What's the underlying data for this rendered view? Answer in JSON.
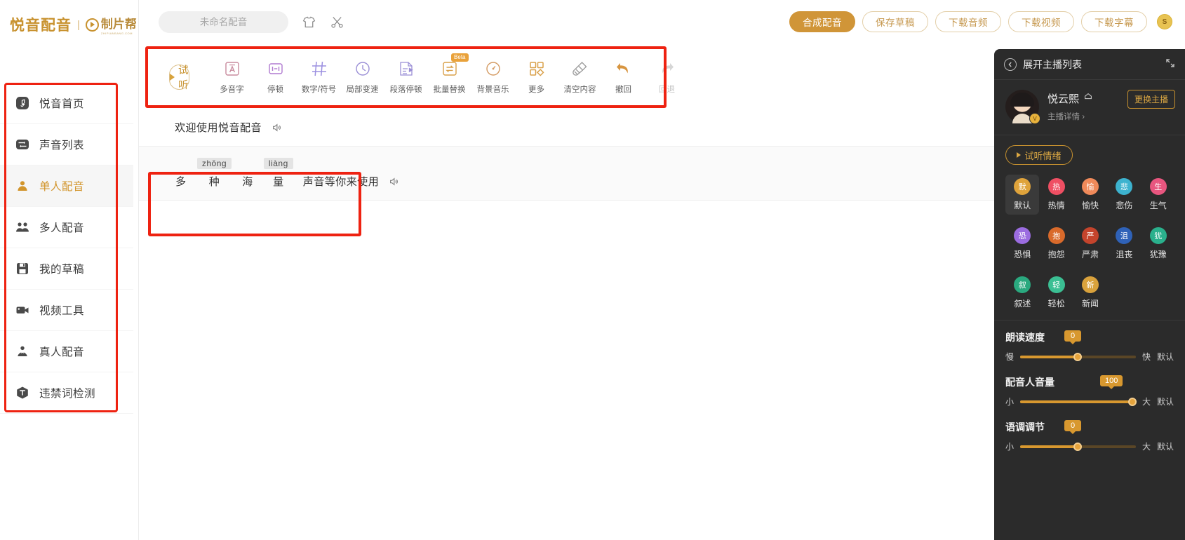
{
  "brand": {
    "name": "悦音配音",
    "divider": "|",
    "partner": "制片帮",
    "partner_sub": "ZHIPIANBANG.COM"
  },
  "sidebar": {
    "items": [
      {
        "label": "悦音首页",
        "icon": "music-note-icon",
        "active": false
      },
      {
        "label": "声音列表",
        "icon": "sound-list-icon",
        "active": false
      },
      {
        "label": "单人配音",
        "icon": "single-person-icon",
        "active": true
      },
      {
        "label": "多人配音",
        "icon": "multi-person-icon",
        "active": false
      },
      {
        "label": "我的草稿",
        "icon": "save-draft-icon",
        "active": false
      },
      {
        "label": "视频工具",
        "icon": "video-camera-icon",
        "active": false
      },
      {
        "label": "真人配音",
        "icon": "real-person-icon",
        "active": false
      },
      {
        "label": "违禁词检测",
        "icon": "banned-word-icon",
        "active": false
      }
    ]
  },
  "topbar": {
    "title_value": "",
    "title_placeholder": "未命名配音",
    "icons": [
      {
        "name": "tshirt-icon"
      },
      {
        "name": "scissors-icon"
      }
    ],
    "buttons": [
      {
        "label": "合成配音",
        "style": "primary"
      },
      {
        "label": "保存草稿",
        "style": "ghost"
      },
      {
        "label": "下载音频",
        "style": "ghost"
      },
      {
        "label": "下载视频",
        "style": "ghost"
      },
      {
        "label": "下载字幕",
        "style": "ghost"
      }
    ],
    "coin_label": "S"
  },
  "toolbar": {
    "preview_label": "试听",
    "tools": [
      {
        "label": "多音字",
        "icon": "polyphone-icon",
        "badge": "",
        "disabled": false
      },
      {
        "label": "停顿",
        "icon": "pause-icon",
        "badge": "",
        "disabled": false
      },
      {
        "label": "数字/符号",
        "icon": "number-symbol-icon",
        "badge": "",
        "disabled": false
      },
      {
        "label": "局部变速",
        "icon": "local-speed-icon",
        "badge": "",
        "disabled": false
      },
      {
        "label": "段落停顿",
        "icon": "paragraph-pause-icon",
        "badge": "",
        "disabled": false
      },
      {
        "label": "批量替换",
        "icon": "batch-replace-icon",
        "badge": "Beta",
        "disabled": false
      },
      {
        "label": "背景音乐",
        "icon": "background-music-icon",
        "badge": "",
        "disabled": false
      },
      {
        "label": "更多",
        "icon": "more-grid-icon",
        "badge": "",
        "disabled": false
      },
      {
        "label": "清空内容",
        "icon": "clear-broom-icon",
        "badge": "",
        "disabled": false
      },
      {
        "label": "撤回",
        "icon": "undo-icon",
        "badge": "",
        "disabled": false
      },
      {
        "label": "回退",
        "icon": "redo-icon",
        "badge": "",
        "disabled": true
      }
    ]
  },
  "editor": {
    "paragraphs": [
      {
        "id": "p1",
        "segments": [
          {
            "type": "plain",
            "text": "欢迎使用悦音配音"
          }
        ],
        "speaker_icon": "speaker-icon"
      },
      {
        "id": "p2",
        "segments": [
          {
            "type": "pinyin",
            "text": "多",
            "pinyin": ""
          },
          {
            "type": "pinyin",
            "text": "种",
            "pinyin": "zhǒng"
          },
          {
            "type": "pinyin",
            "text": "海",
            "pinyin": ""
          },
          {
            "type": "pinyin",
            "text": "量",
            "pinyin": "liàng"
          },
          {
            "type": "plain",
            "text": "声音等你来使用"
          }
        ],
        "speaker_icon": "speaker-icon"
      }
    ]
  },
  "right_panel": {
    "header_title": "展开主播列表",
    "back_icon": "chevron-left-icon",
    "collapse_icon": "collapse-icon",
    "speaker": {
      "name": "悦云熙",
      "crown_icon": "crown-icon",
      "detail_label": "主播详情",
      "detail_arrow": "›",
      "change_label": "更换主播",
      "vip_badge": "V"
    },
    "emotion_preview_label": "试听情绪",
    "emotions": [
      {
        "label": "默认",
        "glyph": "默",
        "color": "#dfa33b",
        "active": true
      },
      {
        "label": "热情",
        "glyph": "热",
        "color": "#ef4f63",
        "active": false
      },
      {
        "label": "愉快",
        "glyph": "愉",
        "color": "#f08a5a",
        "active": false
      },
      {
        "label": "悲伤",
        "glyph": "悲",
        "color": "#3db3cf",
        "active": false
      },
      {
        "label": "生气",
        "glyph": "生",
        "color": "#e8567f",
        "active": false
      },
      {
        "label": "恐惧",
        "glyph": "恐",
        "color": "#9b6ce0",
        "active": false
      },
      {
        "label": "抱怨",
        "glyph": "抱",
        "color": "#d96a2b",
        "active": false
      },
      {
        "label": "严肃",
        "glyph": "严",
        "color": "#c4442c",
        "active": false
      },
      {
        "label": "沮丧",
        "glyph": "沮",
        "color": "#2f62b8",
        "active": false
      },
      {
        "label": "犹豫",
        "glyph": "犹",
        "color": "#2ab08c",
        "active": false
      },
      {
        "label": "叙述",
        "glyph": "叙",
        "color": "#2aa97f",
        "active": false
      },
      {
        "label": "轻松",
        "glyph": "轻",
        "color": "#3bbf93",
        "active": false
      },
      {
        "label": "新闻",
        "glyph": "新",
        "color": "#d9a23c",
        "active": false
      }
    ],
    "sliders": [
      {
        "title": "朗读速度",
        "value": "0",
        "min_label": "慢",
        "max_label": "快",
        "default_label": "默认",
        "percent": 50
      },
      {
        "title": "配音人音量",
        "value": "100",
        "min_label": "小",
        "max_label": "大",
        "default_label": "默认",
        "percent": 97
      },
      {
        "title": "语调调节",
        "value": "0",
        "min_label": "小",
        "max_label": "大",
        "default_label": "默认",
        "percent": 50
      }
    ]
  },
  "annotations": {
    "highlight_color": "#ee2211"
  }
}
